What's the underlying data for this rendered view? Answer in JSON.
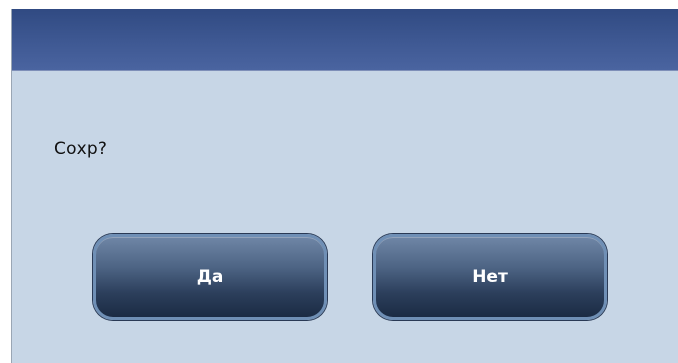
{
  "dialog": {
    "title": "",
    "message": "Сохр?",
    "yes_label": "Да",
    "no_label": "Нет"
  },
  "colors": {
    "titlebar": "#3c5690",
    "body": "#c7d6e6",
    "button": "#2c3f5c",
    "button_border": "#6f8fb5",
    "button_text": "#ffffff"
  }
}
